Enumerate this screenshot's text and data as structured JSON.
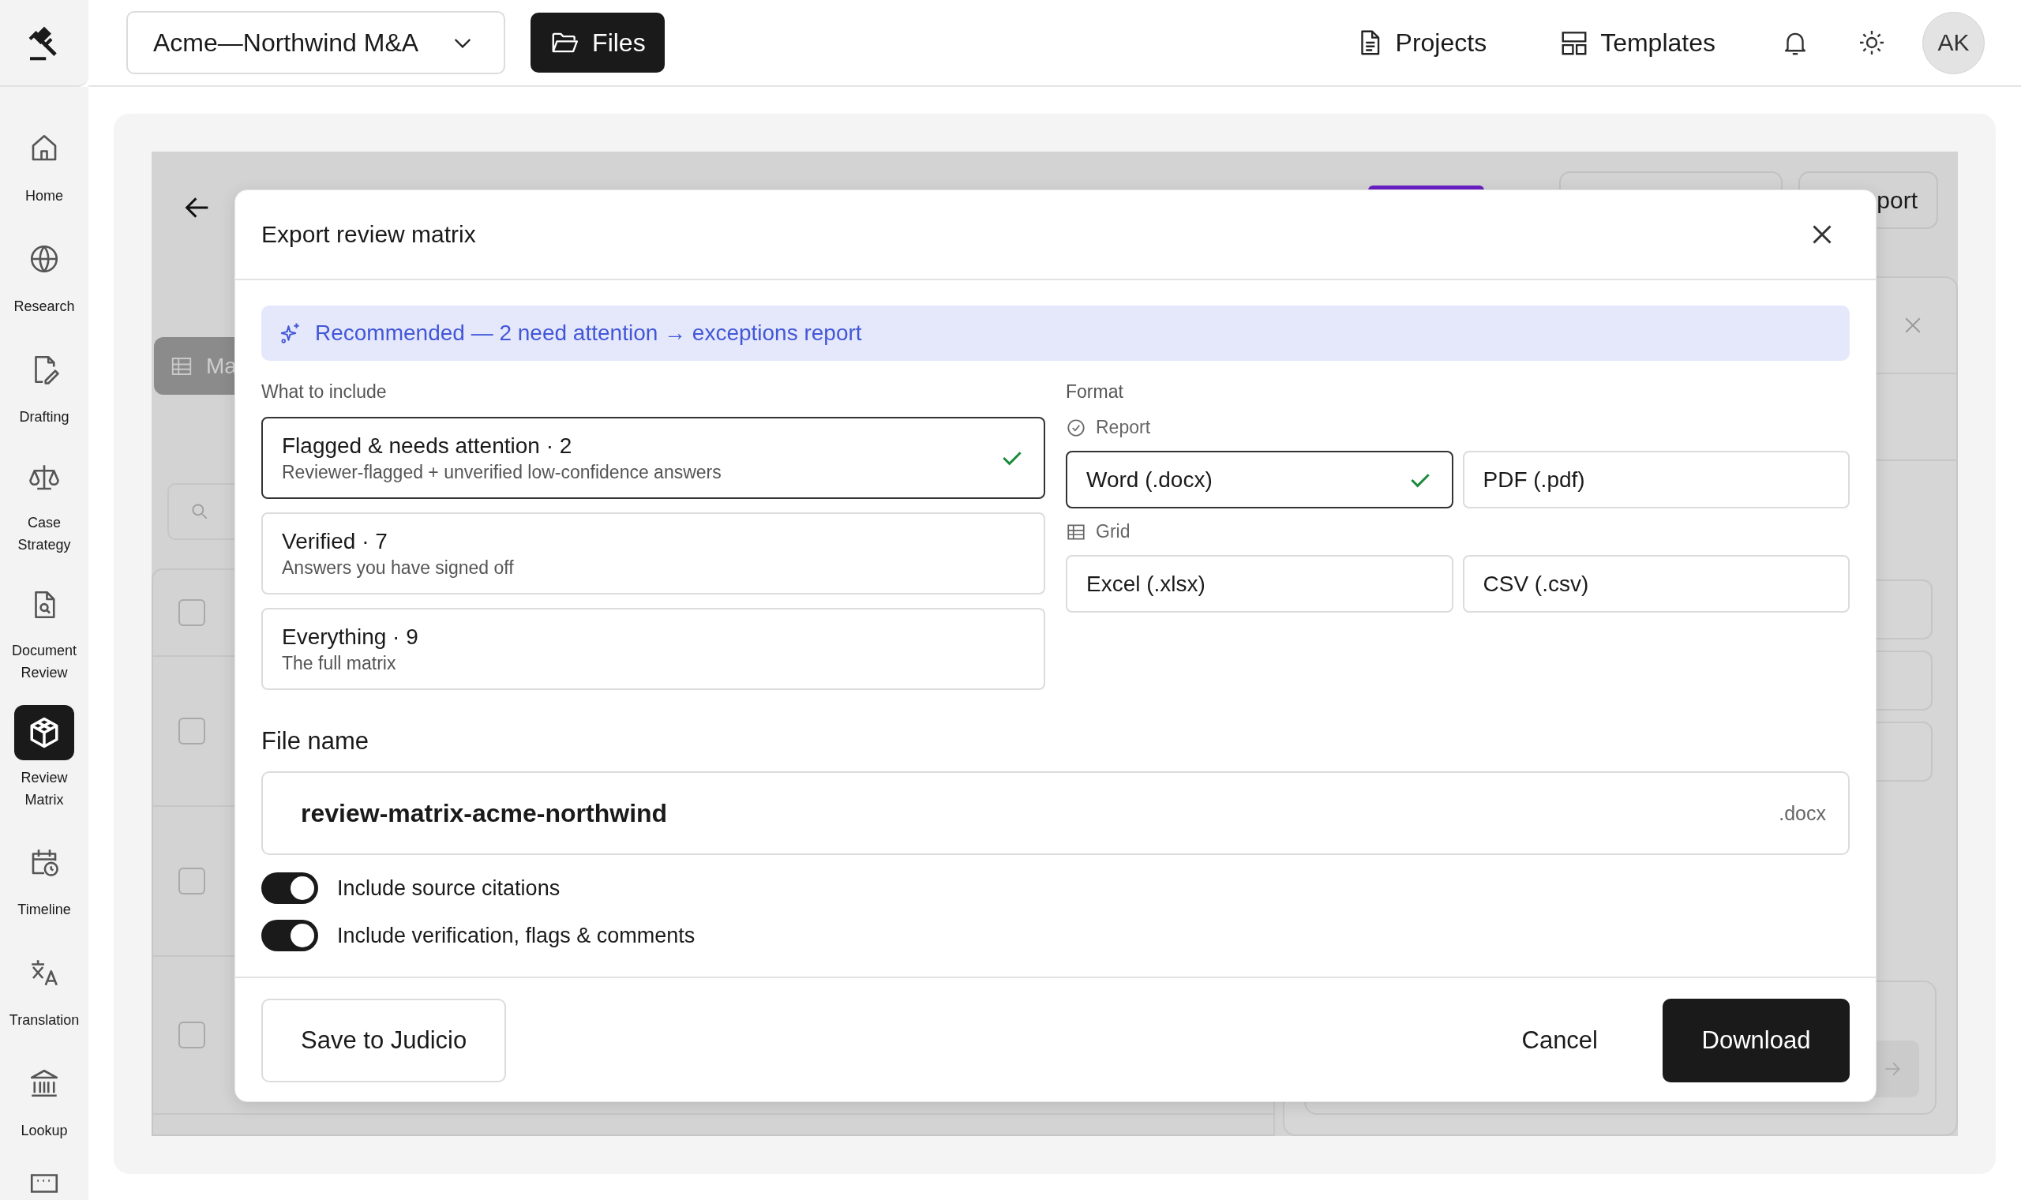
{
  "top_bar": {
    "project_selector": {
      "value": "Acme—Northwind M&A"
    },
    "files_button": "Files",
    "nav": [
      {
        "label": "Projects"
      },
      {
        "label": "Templates"
      }
    ],
    "avatar": "AK"
  },
  "sidebar": {
    "items": [
      {
        "label": "Home",
        "selected": false
      },
      {
        "label": "Research",
        "selected": false
      },
      {
        "label": "Drafting",
        "selected": false
      },
      {
        "label": "Case Strategy",
        "selected": false
      },
      {
        "label": "Document Review",
        "selected": false
      },
      {
        "label": "Review Matrix",
        "selected": true
      },
      {
        "label": "Timeline",
        "selected": false
      },
      {
        "label": "Translation",
        "selected": false
      },
      {
        "label": "Lookup",
        "selected": false
      }
    ]
  },
  "background_page": {
    "export_button": "port",
    "view_tab": "Ma",
    "rows": [
      {
        "checked": false
      },
      {
        "checked": false
      },
      {
        "checked": false
      },
      {
        "checked": false
      }
    ]
  },
  "export_dialog": {
    "title": "Export review matrix",
    "recommendation": "Recommended — 2 need attention → exceptions report",
    "include_label": "What to include",
    "include_options": [
      {
        "title": "Flagged & needs attention · 2",
        "description": "Reviewer-flagged + unverified low-confidence answers",
        "selected": true
      },
      {
        "title": "Verified · 7",
        "description": "Answers you have signed off",
        "selected": false
      },
      {
        "title": "Everything · 9",
        "description": "The full matrix",
        "selected": false
      }
    ],
    "format_label": "Format",
    "format_groups": [
      {
        "label": "Report",
        "options": [
          {
            "label": "Word (.docx)",
            "selected": true
          },
          {
            "label": "PDF (.pdf)",
            "selected": false
          }
        ]
      },
      {
        "label": "Grid",
        "options": [
          {
            "label": "Excel (.xlsx)",
            "selected": false
          },
          {
            "label": "CSV (.csv)",
            "selected": false
          }
        ]
      }
    ],
    "file_name": {
      "label": "File name",
      "value": "review-matrix-acme-northwind",
      "extension": ".docx"
    },
    "toggles": [
      {
        "label": "Include source citations",
        "on": true
      },
      {
        "label": "Include verification, flags & comments",
        "on": true
      }
    ],
    "buttons": {
      "save": "Save to Judicio",
      "cancel": "Cancel",
      "download": "Download"
    }
  }
}
